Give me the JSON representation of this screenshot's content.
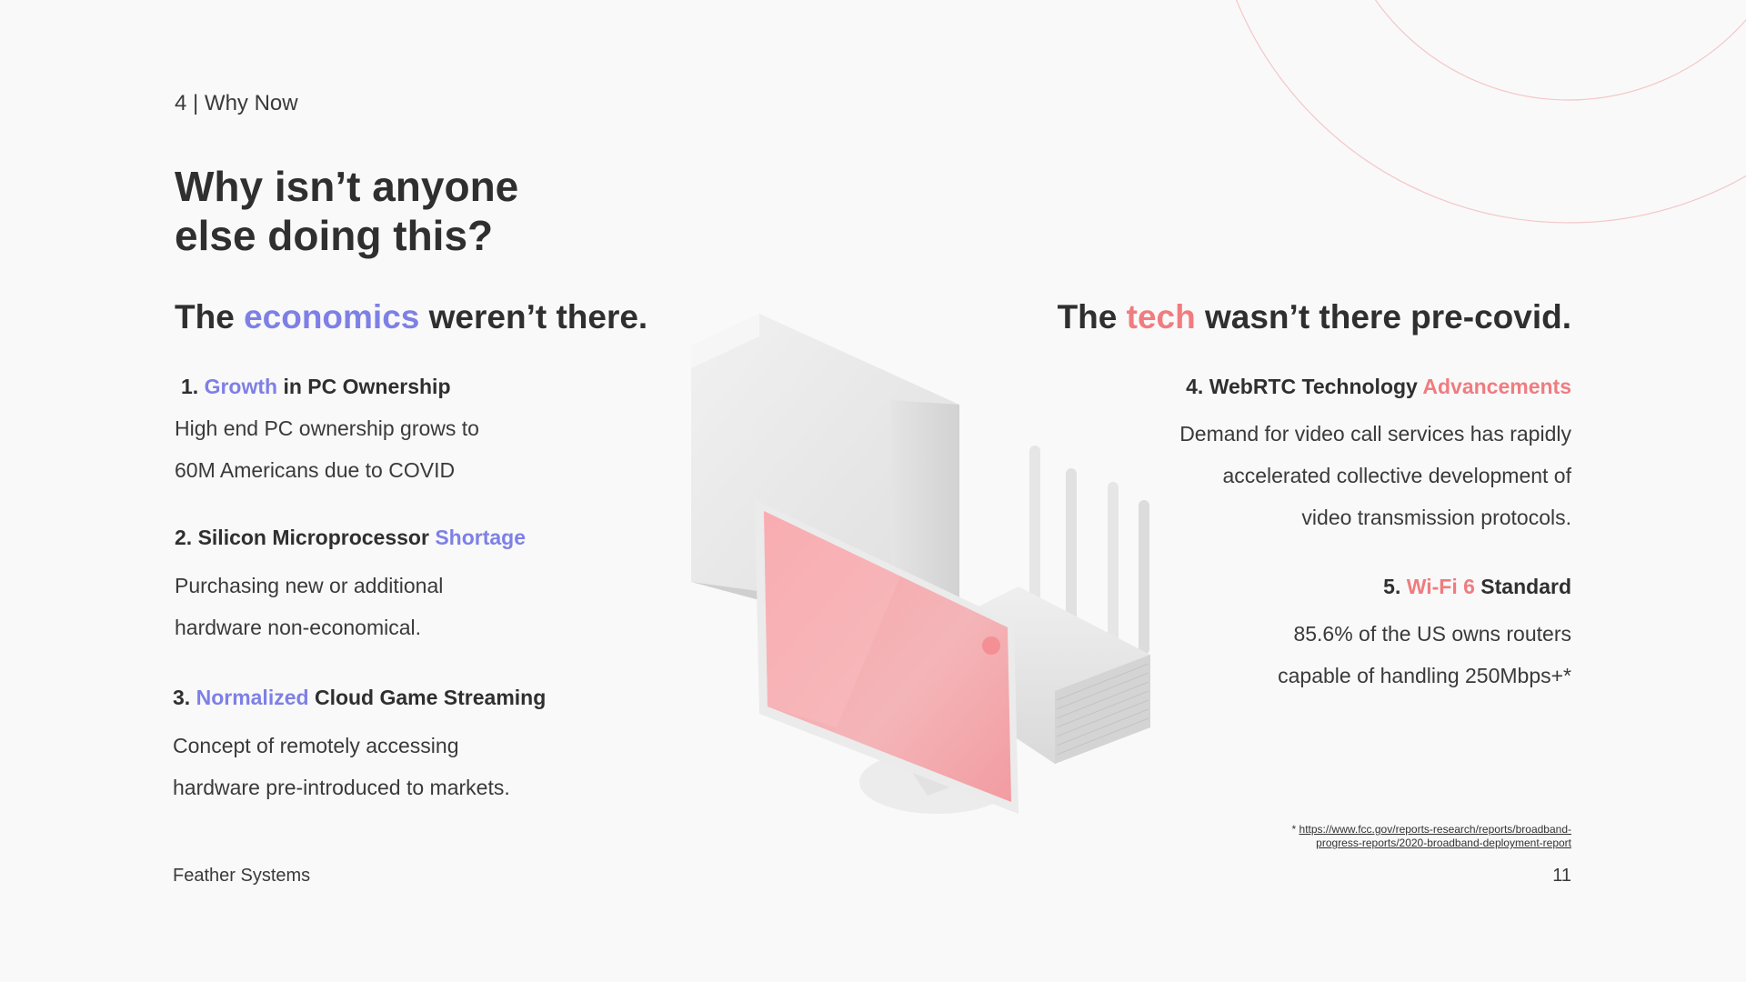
{
  "header": {
    "section_label": "4 | Why Now"
  },
  "title": {
    "line1": "Why isn’t anyone",
    "line2": "else doing this?"
  },
  "left": {
    "heading_pre": "The ",
    "heading_accent": "economics",
    "heading_post": " weren’t there.",
    "items": [
      {
        "num": "1.",
        "accent": "Growth",
        "rest": " in PC Ownership",
        "body_line1": "High end PC ownership grows to",
        "body_line2": "60M Americans due to COVID"
      },
      {
        "num": "2.",
        "rest": "Silicon Microprocessor ",
        "accent": "Shortage",
        "body_line1": "Purchasing new or additional",
        "body_line2": "hardware non-economical."
      },
      {
        "num": "3.",
        "accent": "Normalized",
        "rest": " Cloud Game Streaming",
        "body_line1": "Concept of remotely accessing",
        "body_line2": "hardware pre-introduced to markets."
      }
    ]
  },
  "right": {
    "heading_pre": "The ",
    "heading_accent": "tech",
    "heading_post": " wasn’t there pre-covid.",
    "items": [
      {
        "num": "4.",
        "rest": "WebRTC Technology ",
        "accent": "Advancements",
        "body_line1": "Demand for video call services has rapidly",
        "body_line2": "accelerated collective development of",
        "body_line3": "video transmission protocols."
      },
      {
        "num": "5.",
        "accent": "Wi-Fi 6",
        "rest": " Standard",
        "body_line1": "85.6% of the US owns routers",
        "body_line2": "capable of handling 250Mbps+*"
      }
    ]
  },
  "footnote": {
    "marker": "* ",
    "url_line1": "https://www.fcc.gov/reports-research/reports/broadband-",
    "url_line2": "progress-reports/2020-broadband-deployment-report"
  },
  "footer": {
    "company": "Feather Systems",
    "page_number": "11"
  },
  "colors": {
    "accent_purple": "#7e80e6",
    "accent_coral": "#f07c80",
    "text_dark": "#2f2f2f",
    "background": "#f9f9f9"
  },
  "illustration": {
    "icons": [
      "pc-tower-icon",
      "monitor-icon",
      "router-icon"
    ]
  }
}
